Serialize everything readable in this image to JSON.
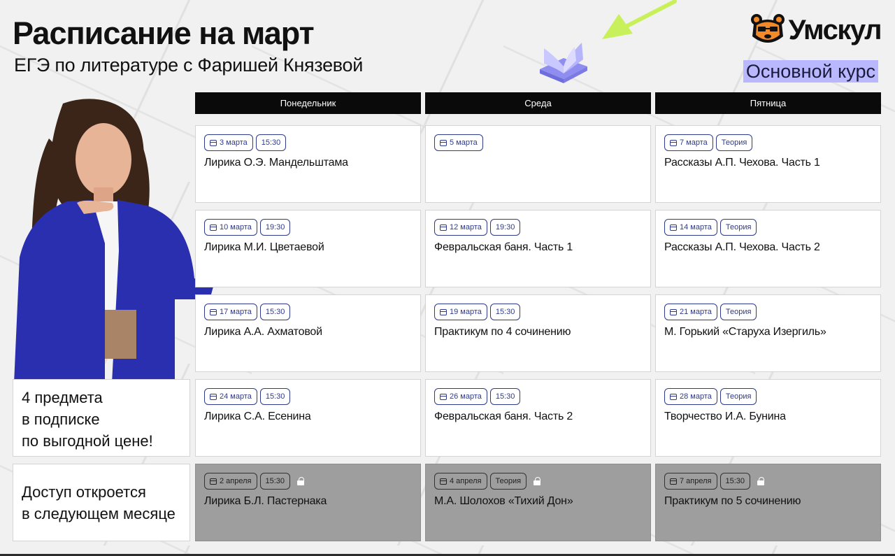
{
  "header": {
    "title": "Расписание на март",
    "subtitle": "ЕГЭ по литературе с Фаришей Князевой",
    "brand": "Умскул",
    "course": "Основной курс"
  },
  "days": [
    "Понедельник",
    "Среда",
    "Пятница"
  ],
  "side": {
    "promo_lines": [
      "4 предмета",
      "в подписке",
      "по выгодной цене!"
    ],
    "locked_lines": [
      "Доступ откроется",
      "в следующем месяце"
    ]
  },
  "schedule": [
    [
      {
        "date": "3 марта",
        "tag": "15:30",
        "title": "Лирика О.Э. Мандельштама"
      },
      {
        "date": "5 марта",
        "tag": "",
        "title": ""
      },
      {
        "date": "7 марта",
        "tag": "Теория",
        "title": "Рассказы А.П. Чехова. Часть 1"
      }
    ],
    [
      {
        "date": "10 марта",
        "tag": "19:30",
        "title": "Лирика М.И. Цветаевой"
      },
      {
        "date": "12 марта",
        "tag": "19:30",
        "title": "Февральская баня. Часть 1"
      },
      {
        "date": "14 марта",
        "tag": "Теория",
        "title": "Рассказы А.П. Чехова. Часть 2"
      }
    ],
    [
      {
        "date": "17 марта",
        "tag": "15:30",
        "title": "Лирика А.А. Ахматовой"
      },
      {
        "date": "19 марта",
        "tag": "15:30",
        "title": "Практикум по 4 сочинению"
      },
      {
        "date": "21 марта",
        "tag": "Теория",
        "title": "М. Горький «Старуха Изергиль»"
      }
    ],
    [
      {
        "date": "24 марта",
        "tag": "15:30",
        "title": "Лирика С.А. Есенина"
      },
      {
        "date": "26 марта",
        "tag": "15:30",
        "title": "Февральская баня. Часть 2"
      },
      {
        "date": "28 марта",
        "tag": "Теория",
        "title": "Творчество И.А. Бунина"
      }
    ],
    [
      {
        "date": "2 апреля",
        "tag": "15:30",
        "title": "Лирика Б.Л. Пастернака"
      },
      {
        "date": "4 апреля",
        "tag": "Теория",
        "title": "М.А. Шолохов «Тихий Дон»"
      },
      {
        "date": "7 апреля",
        "tag": "15:30",
        "title": "Практикум по 5 сочинению"
      }
    ]
  ],
  "colors": {
    "chip_accent": "#2e3a8c",
    "course_highlight": "#b9b8ff",
    "locked_card": "#9e9e9e",
    "header_bar": "#0a0a0a",
    "arrow": "#c8f05a",
    "book": "#a9a8f5"
  },
  "icons": {
    "brand": "bear-logo-icon",
    "book": "open-book-icon",
    "arrow": "arrow-icon",
    "date": "calendar-icon",
    "locked": "lock-icon"
  }
}
